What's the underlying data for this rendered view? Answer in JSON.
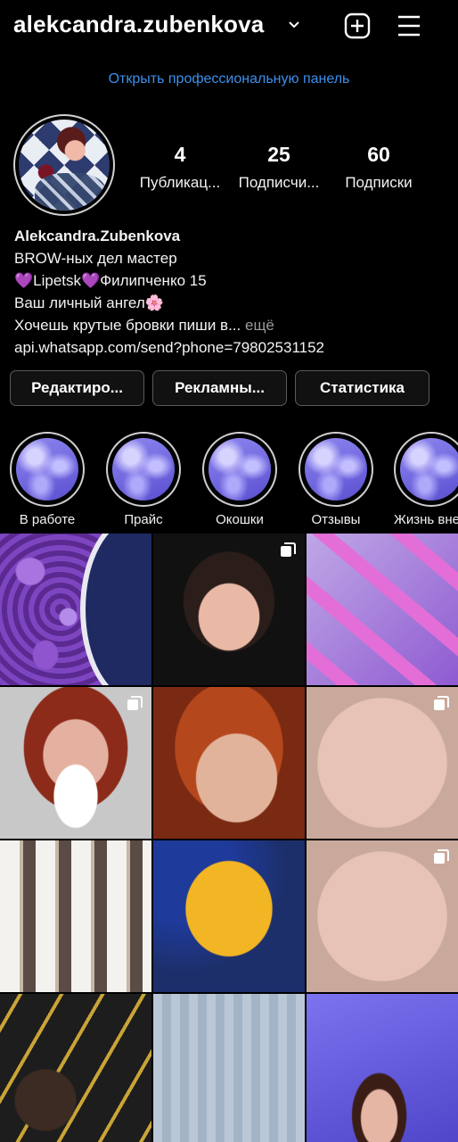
{
  "header": {
    "username": "alekcandra.zubenkova",
    "new_post_icon": "plus-square-icon",
    "menu_icon": "hamburger-menu-icon"
  },
  "professional_dashboard_link": "Открыть профессиональную панель",
  "stats": [
    {
      "count": "4",
      "label": "Публикац..."
    },
    {
      "count": "25",
      "label": "Подписчи..."
    },
    {
      "count": "60",
      "label": "Подписки"
    }
  ],
  "bio": {
    "display_name": "Alekcandra.Zubenkova",
    "line1": "BROW-ных дел мастер",
    "line2": "💜Lipetsk💜Филипченко 15",
    "line3": "Ваш личный ангел🌸",
    "line4": "Хочешь крутые бровки пиши в...",
    "more": "ещё",
    "link": "api.whatsapp.com/send?phone=79802531152"
  },
  "buttons": {
    "edit": "Редактиро...",
    "ads": "Рекламны...",
    "stats": "Статистика"
  },
  "highlights": [
    "В работе",
    "Прайс",
    "Окошки",
    "Отзывы",
    "Жизнь вне работы"
  ],
  "grid": [
    {
      "content": "purple wax beads",
      "multi": false
    },
    {
      "content": "selfie dark hair",
      "multi": true
    },
    {
      "content": "pink eyelash brushes",
      "multi": false
    },
    {
      "content": "red hair with mask",
      "multi": true
    },
    {
      "content": "selfie red hair",
      "multi": false
    },
    {
      "content": "eye close-up",
      "multi": true
    },
    {
      "content": "tint tubes",
      "multi": false
    },
    {
      "content": "yellow oak leaf",
      "multi": false
    },
    {
      "content": "brow close-up",
      "multi": true
    },
    {
      "content": "henna bottles",
      "multi": false
    },
    {
      "content": "brow henna kit",
      "multi": false
    },
    {
      "content": "collage with clouds and portrait",
      "multi": false
    }
  ],
  "colors": {
    "background": "#000000",
    "link": "#3d8fea",
    "more": "#9a9a9a",
    "button_border": "#5a5a5a"
  }
}
